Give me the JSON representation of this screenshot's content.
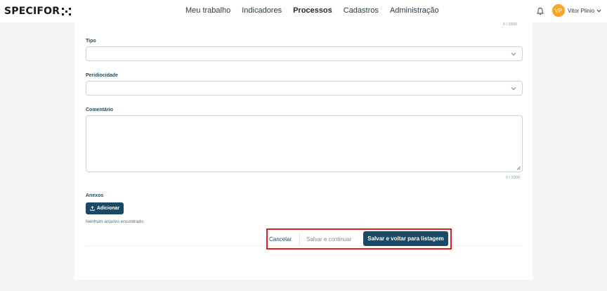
{
  "header": {
    "logo_text": "SPECIFOR",
    "nav": [
      {
        "label": "Meu trabalho",
        "active": false
      },
      {
        "label": "Indicadores",
        "active": false
      },
      {
        "label": "Processos",
        "active": true
      },
      {
        "label": "Cadastros",
        "active": false
      },
      {
        "label": "Administração",
        "active": false
      }
    ],
    "avatar_initials": "VP",
    "user_name": "Vitor Plinio",
    "icons": {
      "notifications": "bell-icon",
      "user_menu": "chevron-down-icon"
    }
  },
  "form": {
    "top_counter": "0 / 2000",
    "tipo": {
      "label": "Tipo",
      "value": ""
    },
    "periodicidade": {
      "label": "Peridiocidade",
      "value": ""
    },
    "comentario": {
      "label": "Comentário",
      "value": "",
      "counter": "0 / 2000"
    },
    "anexos": {
      "label": "Anexos",
      "add_label": "Adicionar",
      "empty_text": "Nenhum arquivo encontrado"
    }
  },
  "actions": {
    "cancel_label": "Cancelar",
    "save_continue_label": "Salvar e continuar",
    "save_back_label": "Salvar e voltar para listagem"
  },
  "colors": {
    "primary": "#1b4a66",
    "avatar": "#f5a623",
    "highlight_frame": "#e02020",
    "background": "#f4f5f7"
  }
}
